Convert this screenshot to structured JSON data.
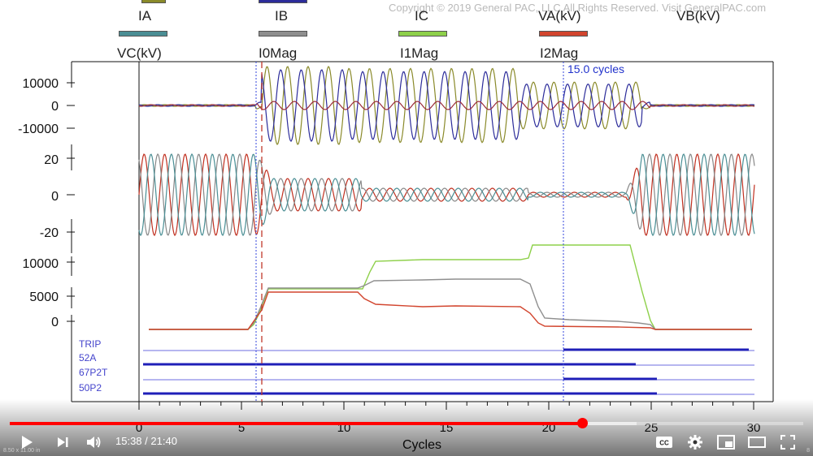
{
  "copyright": "Copyright © 2019 General PAC, LLC All Rights Reserved. Visit GeneralPAC.com",
  "legend_row1": [
    {
      "label": "IA",
      "color": "#8a8a2a",
      "show_swatch": true
    },
    {
      "label": "IB",
      "color": "#2c2c9a",
      "show_swatch": true
    },
    {
      "label": "IC",
      "color": "#9b2c3a",
      "show_swatch": true
    },
    {
      "label": "VA(kV)",
      "color": "#c03020",
      "show_swatch": false
    },
    {
      "label": "VB(kV)",
      "color": "#444444",
      "show_swatch": false
    }
  ],
  "legend_row2": [
    {
      "label": "VC(kV)",
      "color": "#4a8e94"
    },
    {
      "label": "I0Mag",
      "color": "#8f8f8f"
    },
    {
      "label": "I1Mag",
      "color": "#8ed04a"
    },
    {
      "label": "I2Mag",
      "color": "#d2452e"
    }
  ],
  "cursor_label": "15.0 cycles",
  "xaxis": {
    "label": "Cycles",
    "ticks": [
      "0",
      "5",
      "10",
      "15",
      "20",
      "25",
      "30"
    ]
  },
  "panel_currents": {
    "ticks": [
      "10000",
      "0",
      "-10000"
    ]
  },
  "panel_voltages": {
    "ticks": [
      "20",
      "0",
      "-20"
    ]
  },
  "panel_sequence": {
    "ticks": [
      "10000",
      "5000",
      "0"
    ]
  },
  "digital_channels": [
    "TRIP",
    "52A",
    "67P2T",
    "50P2"
  ],
  "player": {
    "current_time": "15:38",
    "duration": "21:40",
    "played_fraction": 0.7215,
    "buffered_fraction": 0.79
  },
  "bottom_caption_left": "8.50 x 11.00 in",
  "bottom_caption_right": "8"
}
